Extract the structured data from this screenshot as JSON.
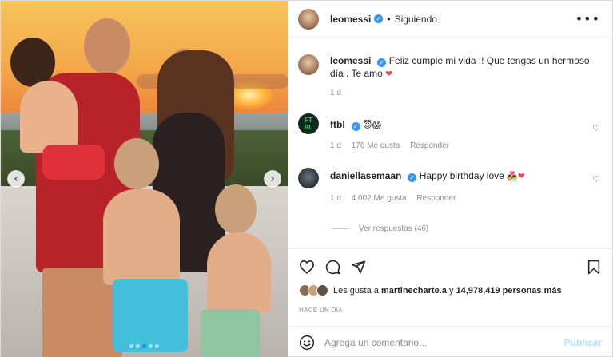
{
  "post": {
    "username": "leomessi",
    "follow_status": "Siguiendo",
    "separator": "•",
    "more_label": "•••"
  },
  "caption": {
    "username": "leomessi",
    "text": "Feliz cumple mi vida !! Que tengas un hermoso día . Te amo",
    "time": "1 d"
  },
  "comments": [
    {
      "username": "ftbl",
      "avatar_text": "FTBL",
      "text": "😇😱",
      "time": "1 d",
      "likes": "176 Me gusta",
      "reply": "Responder"
    },
    {
      "username": "daniellasemaan",
      "text": "Happy birthday love",
      "text_emoji": "👩‍❤️‍👨",
      "time": "1 d",
      "likes": "4.002 Me gusta",
      "reply": "Responder"
    }
  ],
  "view_replies": "Ver respuestas (46)",
  "likes": {
    "prefix": "Les gusta a",
    "user": "martinecharte.a",
    "middle": "y",
    "count": "14,978,419 personas más"
  },
  "time_ago": "HACE UN DÍA",
  "composer": {
    "placeholder": "Agrega un comentario...",
    "publish": "Publicar"
  },
  "colors": {
    "accent": "#0095f6",
    "verified": "#3897f0",
    "like_red": "#ed4956",
    "publish_disabled": "#b2dffc"
  },
  "icons": {
    "verified": "verified-badge-icon",
    "heart": "heart-icon",
    "comment": "comment-icon",
    "share": "share-icon",
    "save": "bookmark-icon",
    "emoji": "emoji-icon"
  }
}
